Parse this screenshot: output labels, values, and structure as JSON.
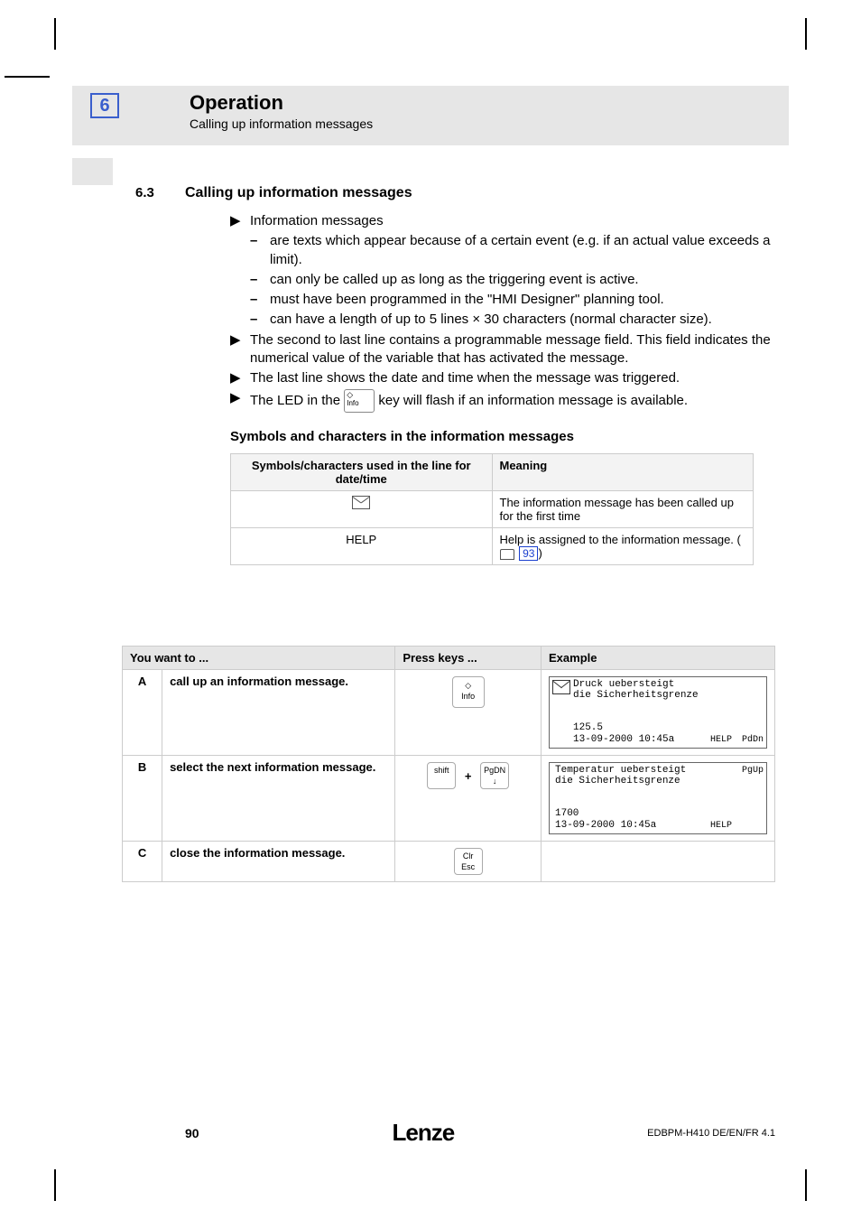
{
  "chapter": {
    "num": "6",
    "title": "Operation",
    "subtitle": "Calling up information messages"
  },
  "section": {
    "num": "6.3",
    "title": "Calling up information messages"
  },
  "bullets": {
    "b1": "Information messages",
    "b1a": "are texts which appear because of a certain event (e.g. if an actual value exceeds a limit).",
    "b1b": "can only be called up as long as the triggering event is active.",
    "b1c": "must have been programmed in the \"HMI Designer\" planning tool.",
    "b1d": "can have a length of up to 5 lines × 30 characters (normal character size).",
    "b2": "The second to last line contains a programmable message field. This field indicates the numerical value of the variable that has activated the message.",
    "b3": "The last line shows the date and time when the message was triggered.",
    "b4a": "The LED in the ",
    "b4b": " key will flash if an information message is available."
  },
  "key_info_label": "Info",
  "subheading": "Symbols and characters in the information messages",
  "sym_table": {
    "h1": "Symbols/characters used in the line for date/time",
    "h2": "Meaning",
    "r1c2": "The information message has been called up for the first time",
    "r2c1": "HELP",
    "r2c2a": "Help is assigned to the information message. (",
    "r2c2b": "93",
    "r2c2c": ")"
  },
  "steps_table": {
    "h1": "You want to ...",
    "h2": "Press keys ...",
    "h3": "Example",
    "rows": [
      {
        "id": "A",
        "action": "call up an information message.",
        "key1": "Info",
        "lcd": {
          "env": true,
          "l1": "Druck uebersteigt",
          "l2": "die Sicherheitsgrenze",
          "l4": "125.5",
          "l5": "13-09-2000 10:45a",
          "help": "HELP",
          "corner_bot": "PdDn"
        }
      },
      {
        "id": "B",
        "action": "select the next information message.",
        "key1": "shift",
        "key2": "PgDN",
        "key2arrow": "↓",
        "lcd": {
          "env": false,
          "l1": "Temperatur uebersteigt",
          "l2": "die Sicherheitsgrenze",
          "l4": "1700",
          "l5": "13-09-2000 10:45a",
          "help": "HELP",
          "corner_top": "PgUp"
        }
      },
      {
        "id": "C",
        "action": "close the information message.",
        "key1": "Clr",
        "key1b": "Esc"
      }
    ]
  },
  "footer": {
    "page": "90",
    "logo": "Lenze",
    "docid": "EDBPM-H410 DE/EN/FR 4.1"
  }
}
